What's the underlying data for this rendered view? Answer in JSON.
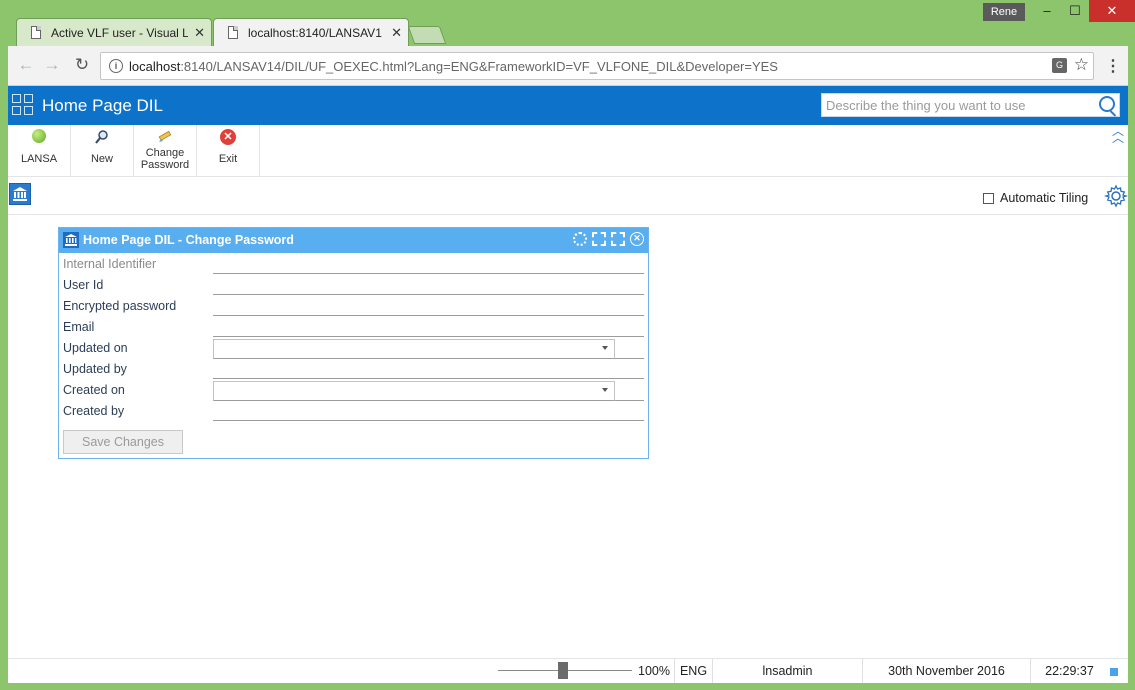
{
  "browser": {
    "tabs": [
      {
        "label": "Active VLF user - Visual L",
        "active": false
      },
      {
        "label": "localhost:8140/LANSAV1",
        "active": true
      }
    ],
    "profile": "Rene",
    "url_host": "localhost",
    "url_rest": ":8140/LANSAV14/DIL/UF_OEXEC.html?Lang=ENG&FrameworkID=VF_VLFONE_DIL&Developer=YES"
  },
  "app": {
    "title": "Home Page DIL",
    "search_placeholder": "Describe the thing you want to use",
    "accent": "#0d72c9"
  },
  "ribbon": {
    "buttons": [
      {
        "label": "LANSA",
        "icon": "lansa-icon"
      },
      {
        "label": "New",
        "icon": "magnifier-icon"
      },
      {
        "label": "Change Password",
        "icon": "pencil-icon"
      },
      {
        "label": "Exit",
        "icon": "exit-icon"
      }
    ]
  },
  "workspace": {
    "auto_tiling_label": "Automatic Tiling",
    "auto_tiling_checked": false
  },
  "dialog": {
    "title": "Home Page DIL - Change Password",
    "fields": [
      {
        "label": "Internal Identifier",
        "type": "text",
        "value": "",
        "disabled": true
      },
      {
        "label": "User Id",
        "type": "text",
        "value": ""
      },
      {
        "label": "Encrypted password",
        "type": "text",
        "value": ""
      },
      {
        "label": "Email",
        "type": "text",
        "value": ""
      },
      {
        "label": "Updated on",
        "type": "select",
        "value": ""
      },
      {
        "label": "Updated by",
        "type": "text",
        "value": ""
      },
      {
        "label": "Created on",
        "type": "select",
        "value": ""
      },
      {
        "label": "Created by",
        "type": "text",
        "value": ""
      }
    ],
    "save_label": "Save Changes"
  },
  "status": {
    "zoom": "100%",
    "language": "ENG",
    "user": "lnsadmin",
    "date": "30th November 2016",
    "time": "22:29:37"
  }
}
